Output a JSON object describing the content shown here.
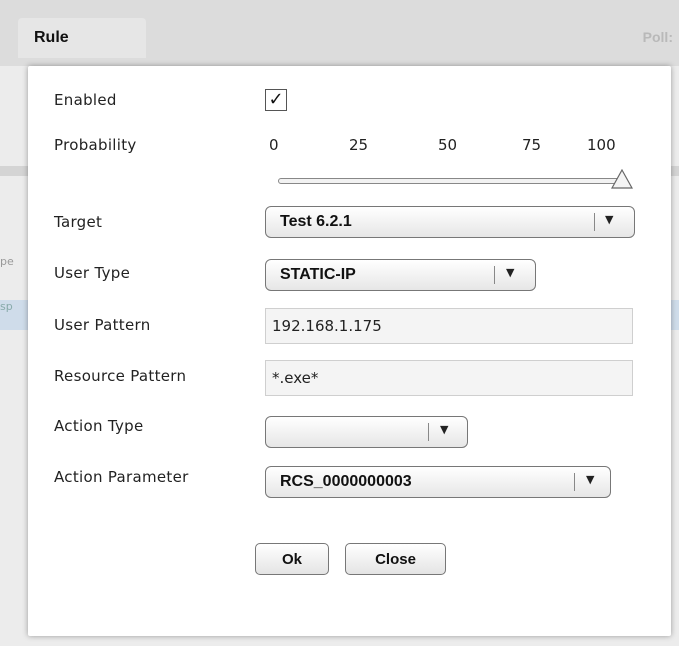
{
  "background": {
    "tab_title": "Rule",
    "poll_label": "Poll:",
    "left_fragment_1": "pe",
    "left_fragment_2": "sp"
  },
  "dialog": {
    "labels": {
      "enabled": "Enabled",
      "probability": "Probability",
      "target": "Target",
      "user_type": "User Type",
      "user_pattern": "User Pattern",
      "resource_pattern": "Resource Pattern",
      "action_type": "Action Type",
      "action_parameter": "Action Parameter"
    },
    "enabled_checked": true,
    "checkmark": "✓",
    "probability": {
      "ticks": [
        "0",
        "25",
        "50",
        "75",
        "100"
      ],
      "value": 100
    },
    "target_value": "Test 6.2.1",
    "user_type_value": "STATIC-IP",
    "user_pattern_value": "192.168.1.175",
    "resource_pattern_value": "*.exe*",
    "action_type_value": "",
    "action_parameter_value": "RCS_0000000003",
    "dropdown_arrow": "▼",
    "ok_label": "Ok",
    "close_label": "Close"
  }
}
